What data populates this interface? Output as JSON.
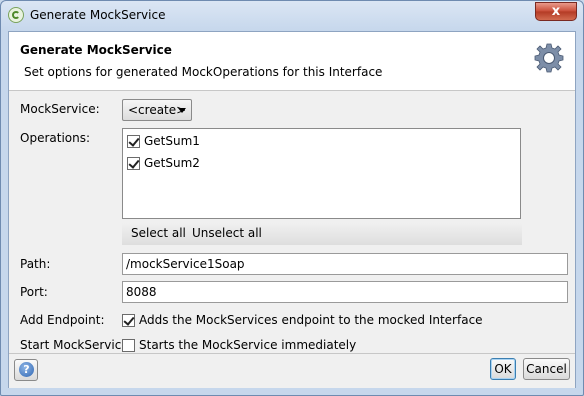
{
  "window": {
    "title": "Generate MockService",
    "close_label": "x"
  },
  "header": {
    "title": "Generate MockService",
    "description": "Set options for generated MockOperations for this Interface"
  },
  "form": {
    "mockservice_label": "MockService:",
    "mockservice_value": "<create>",
    "operations_label": "Operations:",
    "operations": [
      {
        "name": "GetSum1",
        "checked": true
      },
      {
        "name": "GetSum2",
        "checked": true
      }
    ],
    "select_all": "Select all",
    "unselect_all": "Unselect all",
    "path_label": "Path:",
    "path_value": "/mockService1Soap",
    "port_label": "Port:",
    "port_value": "8088",
    "add_endpoint_label": "Add Endpoint:",
    "add_endpoint_text": "Adds the MockServices endpoint to the mocked Interface",
    "add_endpoint_checked": true,
    "start_label": "Start MockService:",
    "start_text": "Starts the MockService immediately",
    "start_checked": false
  },
  "footer": {
    "help_icon": "?",
    "ok_label": "OK",
    "cancel_label": "Cancel"
  },
  "icons": {
    "app": "soapui-logo-icon",
    "header": "gear-icon",
    "help": "help-icon"
  }
}
